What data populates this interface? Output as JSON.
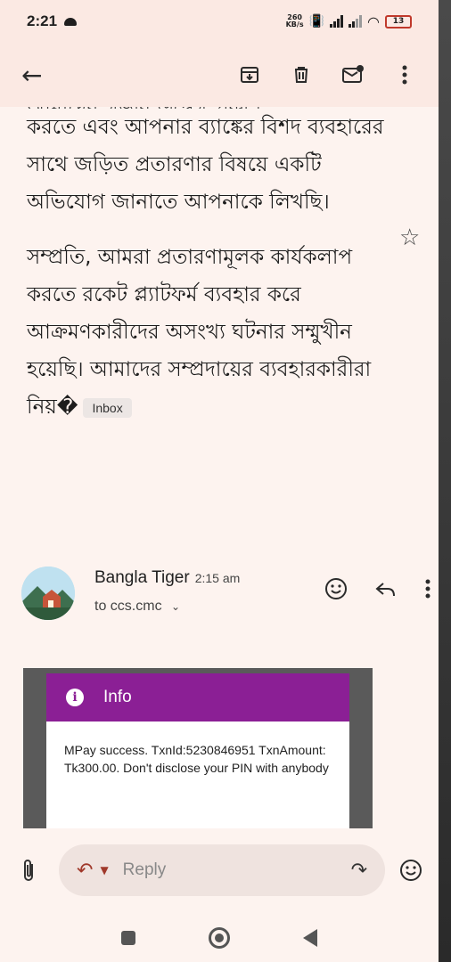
{
  "status": {
    "time": "2:21",
    "net_speed_value": "260",
    "net_speed_unit": "KB/s",
    "battery": "13"
  },
  "toolbar": {
    "back_icon": "arrow-back-icon",
    "archive_icon": "archive-icon",
    "delete_icon": "delete-icon",
    "unread_icon": "mark-unread-icon",
    "more_icon": "more-vert-icon"
  },
  "message": {
    "cut_line": "আমাদের গভীর উদ্বেগ প্রকাশ",
    "para1": "করতে এবং আপনার ব্যাঙ্কের বিশদ ব্যবহারের সাথে জড়িত প্রতারণার বিষয়ে একটি অভিযোগ জানাতে আপনাকে লিখছি।",
    "para2": "সম্প্রতি, আমরা প্রতারণামূলক কার্যকলাপ করতে রকেট প্ল্যাটফর্ম ব্যবহার করে আক্রমণকারীদের অসংখ্য ঘটনার সম্মুখীন হয়েছি। আমাদের সম্প্রদায়ের ব্যবহারকারীরা নিয়�",
    "label": "Inbox"
  },
  "sender": {
    "name": "Bangla Tiger",
    "time": "2:15 am",
    "to": "to ccs.cmc"
  },
  "attachment": {
    "title": "Info",
    "text": "MPay success. TxnId:5230846951 TxnAmount: Tk300.00. Don't disclose your PIN with anybody"
  },
  "reply": {
    "label": "Reply"
  },
  "colors": {
    "background": "#fdf3ef",
    "header": "#fbe9e3",
    "info_header": "#8b1f95"
  }
}
